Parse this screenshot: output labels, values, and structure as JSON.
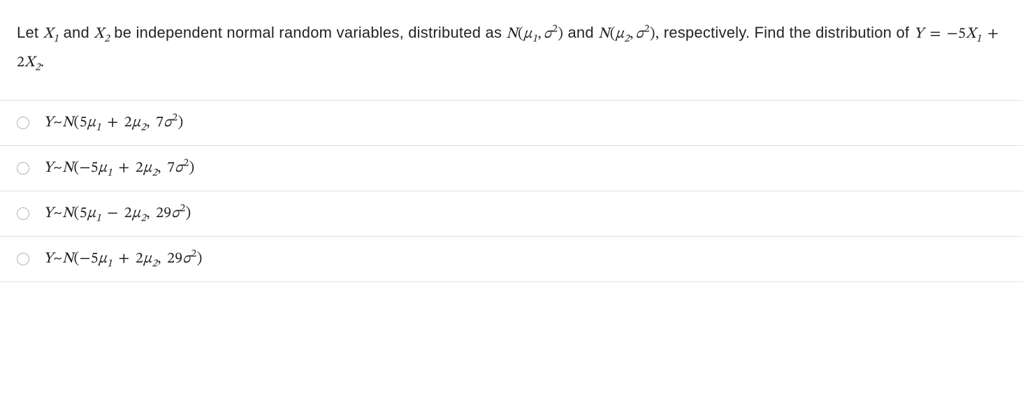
{
  "question": {
    "prefix": "Let ",
    "var1": "X",
    "var1_sub": "1",
    "and1": " and ",
    "var2": "X",
    "var2_sub": "2",
    "middle1": " be independent normal random variables, distributed as ",
    "dist1_N": "N",
    "dist1_open": "(",
    "dist1_mu": "μ",
    "dist1_mu_sub": "1",
    "dist1_comma": ",",
    "dist1_sigma": "σ",
    "dist1_sigma_sup": "2",
    "dist1_close": ")",
    "and2": " and ",
    "dist2_N": "N",
    "dist2_open": "(",
    "dist2_mu": "μ",
    "dist2_mu_sub": "2",
    "dist2_comma": ",",
    "dist2_sigma": "σ",
    "dist2_sigma_sup": "2",
    "dist2_close": "),",
    "middle2": " respectively. Find the distribution of ",
    "Y": "Y",
    "eq": " = ",
    "neg5": "−5",
    "X1": "X",
    "X1_sub": "1",
    "plus": " + ",
    "two": "2",
    "X2": "X",
    "X2_sub": "2",
    "period": "."
  },
  "options": [
    {
      "Y": "Y",
      "tilde": "~",
      "N": "N",
      "open": "(",
      "coef1": "5",
      "mu1": "μ",
      "mu1_sub": "1",
      "op1": " + ",
      "coef2": "2",
      "mu2": "μ",
      "mu2_sub": "2",
      "comma": ",",
      "coefvar": "7",
      "sigma": "σ",
      "sigma_sup": "2",
      "close": ")"
    },
    {
      "Y": "Y",
      "tilde": "~",
      "N": "N",
      "open": "(",
      "coef1": "−5",
      "mu1": "μ",
      "mu1_sub": "1",
      "op1": " + ",
      "coef2": "2",
      "mu2": "μ",
      "mu2_sub": "2",
      "comma": ",",
      "coefvar": "7",
      "sigma": "σ",
      "sigma_sup": "2",
      "close": ")"
    },
    {
      "Y": "Y",
      "tilde": "~",
      "N": "N",
      "open": "(",
      "coef1": "5",
      "mu1": "μ",
      "mu1_sub": "1",
      "op1": " − ",
      "coef2": "2",
      "mu2": "μ",
      "mu2_sub": "2",
      "comma": ",",
      "coefvar": "29",
      "sigma": "σ",
      "sigma_sup": "2",
      "close": ")"
    },
    {
      "Y": "Y",
      "tilde": "~",
      "N": "N",
      "open": "(",
      "coef1": "−5",
      "mu1": "μ",
      "mu1_sub": "1",
      "op1": " + ",
      "coef2": "2",
      "mu2": "μ",
      "mu2_sub": "2",
      "comma": ",",
      "coefvar": "29",
      "sigma": "σ",
      "sigma_sup": "2",
      "close": ")"
    }
  ]
}
